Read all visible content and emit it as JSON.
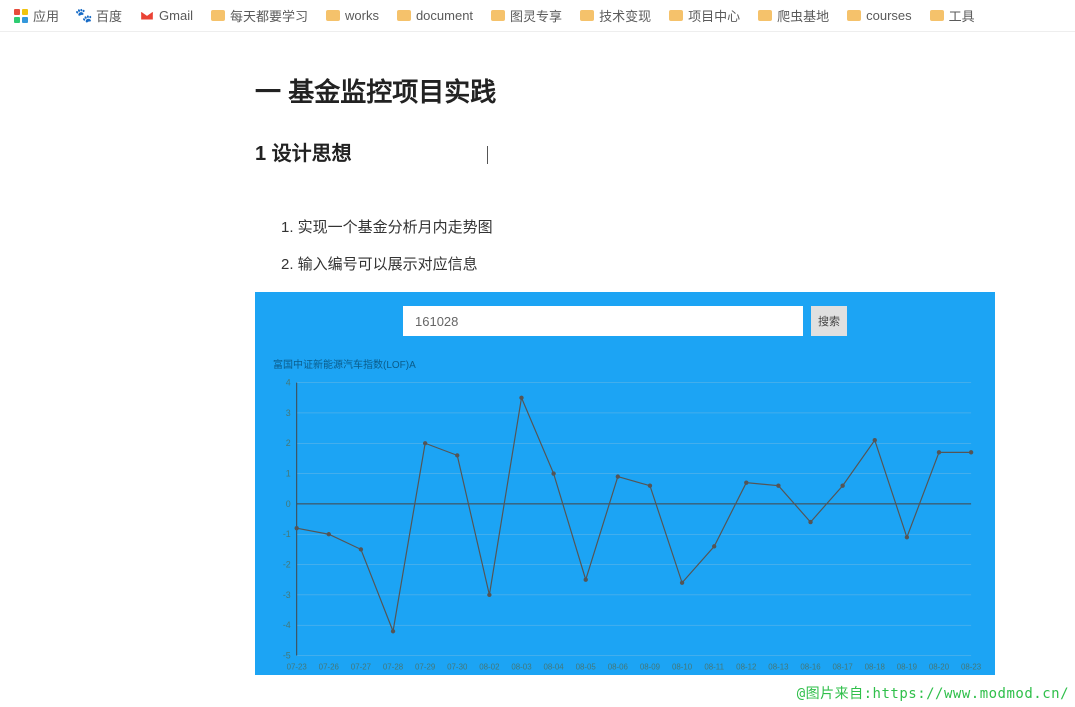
{
  "bookmarks": {
    "apps_label": "应用",
    "items": [
      {
        "label": "百度",
        "icon": "baidu"
      },
      {
        "label": "Gmail",
        "icon": "gmail"
      },
      {
        "label": "每天都要学习",
        "icon": "folder"
      },
      {
        "label": "works",
        "icon": "folder"
      },
      {
        "label": "document",
        "icon": "folder"
      },
      {
        "label": "图灵专享",
        "icon": "folder"
      },
      {
        "label": "技术变现",
        "icon": "folder"
      },
      {
        "label": "项目中心",
        "icon": "folder"
      },
      {
        "label": "爬虫基地",
        "icon": "folder"
      },
      {
        "label": "courses",
        "icon": "folder"
      },
      {
        "label": "工具",
        "icon": "folder"
      }
    ]
  },
  "page": {
    "title": "一 基金监控项目实践",
    "section": "1 设计思想",
    "list": [
      "1. 实现一个基金分析月内走势图",
      "2. 输入编号可以展示对应信息"
    ]
  },
  "search": {
    "value": "161028",
    "button_label": "搜索"
  },
  "chart_title": "富国中证新能源汽车指数(LOF)A",
  "chart_data": {
    "type": "line",
    "title": "富国中证新能源汽车指数(LOF)A",
    "xlabel": "",
    "ylabel": "",
    "ylim": [
      -5,
      4
    ],
    "y_ticks": [
      -5,
      -4,
      -3,
      -2,
      -1,
      0,
      1,
      2,
      3,
      4
    ],
    "categories": [
      "07-23",
      "07-26",
      "07-27",
      "07-28",
      "07-29",
      "07-30",
      "08-02",
      "08-03",
      "08-04",
      "08-05",
      "08-06",
      "08-09",
      "08-10",
      "08-11",
      "08-12",
      "08-13",
      "08-16",
      "08-17",
      "08-18",
      "08-19",
      "08-20",
      "08-23"
    ],
    "values": [
      -0.8,
      -1.0,
      -1.5,
      -4.2,
      2.0,
      1.6,
      -3.0,
      3.5,
      1.0,
      -2.5,
      0.9,
      0.6,
      -2.6,
      -1.4,
      0.7,
      0.6,
      -0.6,
      0.6,
      2.1,
      -1.1,
      1.7,
      1.7
    ]
  },
  "watermark": "@图片来自:https://www.modmod.cn/"
}
